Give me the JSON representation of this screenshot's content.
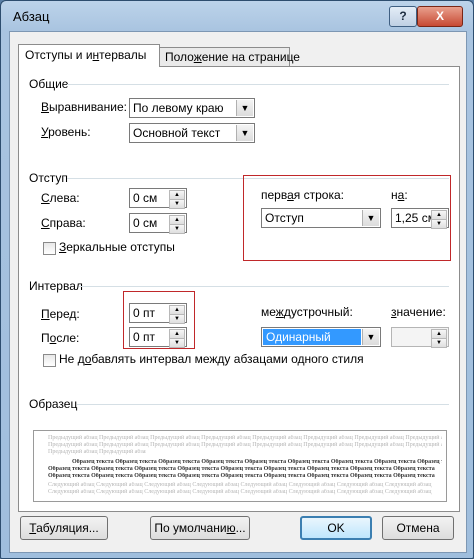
{
  "window": {
    "title": "Абзац",
    "help_label": "?",
    "close_label": "X"
  },
  "tabs": [
    {
      "label_pre": "Отступы и и",
      "label_u": "н",
      "label_post": "тервалы"
    },
    {
      "label_pre": "Поло",
      "label_u": "ж",
      "label_post": "ение на странице"
    }
  ],
  "general": {
    "title": "Общие",
    "alignment": {
      "label_u": "В",
      "label_rest": "ыравнивание:",
      "value": "По левому краю"
    },
    "level": {
      "label_u": "У",
      "label_rest": "ровень:",
      "value": "Основной текст"
    }
  },
  "indent": {
    "title": "Отступ",
    "left": {
      "label_u": "С",
      "label_rest": "лева:",
      "value": "0 см"
    },
    "right": {
      "label_u": "С",
      "label_rest": "права:",
      "value": "0 см"
    },
    "mirror": {
      "label_u": "З",
      "label_rest": "еркальные отступы",
      "checked": false
    },
    "first_line": {
      "label_pre": "перв",
      "label_u": "а",
      "label_post": "я строка:",
      "value": "Отступ"
    },
    "by": {
      "label_pre": "н",
      "label_u": "а",
      "label_post": ":",
      "value": "1,25 см"
    }
  },
  "spacing": {
    "title": "Интервал",
    "before": {
      "label_u": "П",
      "label_rest": "еред:",
      "value": "0 пт"
    },
    "after": {
      "label_pre": "П",
      "label_u": "о",
      "label_post": "сле:",
      "value": "0 пт"
    },
    "line_spacing": {
      "label_pre": "ме",
      "label_u": "ж",
      "label_post": "дустрочный:",
      "value": "Одинарный"
    },
    "at": {
      "label_pre": "",
      "label_u": "з",
      "label_post": "начение:",
      "value": ""
    },
    "no_space": {
      "label_pre": "Не д",
      "label_u": "о",
      "label_post": "бавлять интервал между абзацами одного стиля",
      "checked": false
    }
  },
  "preview": {
    "title": "Образец",
    "prev_text": "Предыдущий абзац Предыдущий абзац Предыдущий абзац Предыдущий абзац Предыдущий абзац Предыдущий абзац Предыдущий абзац Предыдущий абзац",
    "sample_text": "Образец текста Образец текста Образец текста Образец текста Образец текста Образец текста Образец текста Образец текста Образец текста",
    "next_text": "Следующий абзац Следующий абзац Следующий абзац Следующий абзац Следующий абзац Следующий абзац Следующий абзац Следующий абзац"
  },
  "buttons": {
    "tabs": {
      "label_u": "Т",
      "label_rest": "абуляция..."
    },
    "default": {
      "label_pre": "По умолчани",
      "label_u": "ю",
      "label_post": "..."
    },
    "ok": "OK",
    "cancel": "Отмена"
  },
  "colors": {
    "highlight_box": "#c0282a",
    "selection": "#3399ff"
  }
}
